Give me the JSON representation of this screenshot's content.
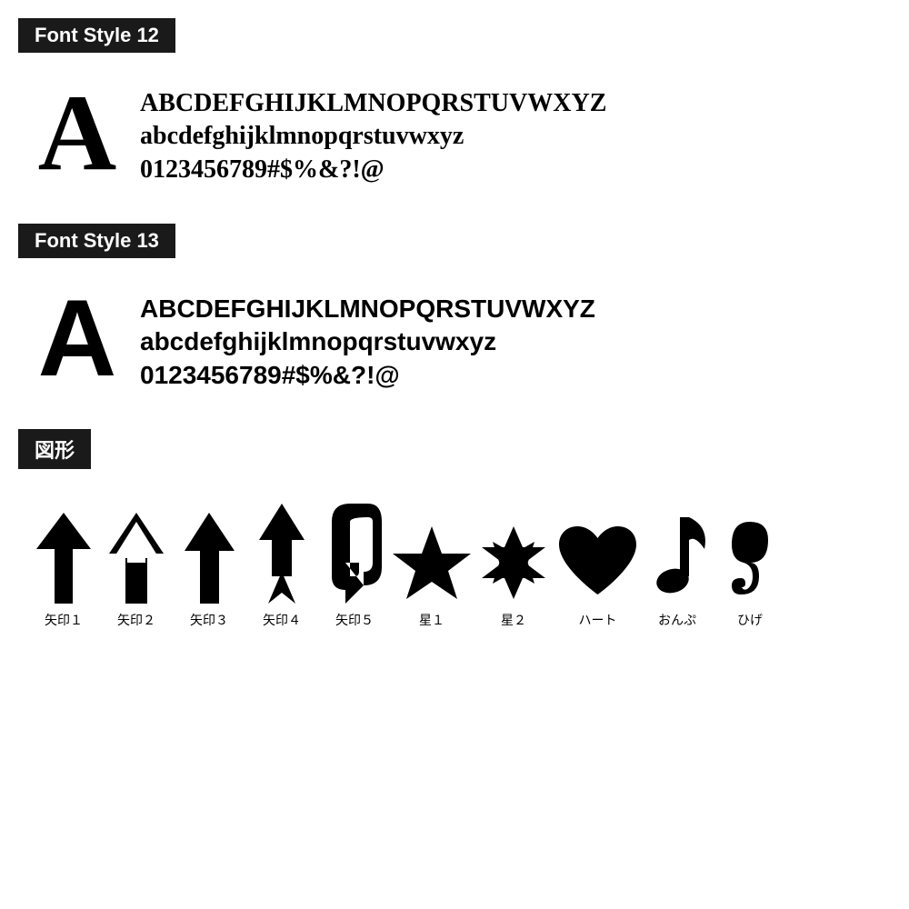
{
  "sections": [
    {
      "id": "font-style-12",
      "label": "Font Style 12",
      "bigLetter": "A",
      "lines": [
        "ABCDEFGHIJKLMNOPQRSTUVWXYZ",
        "abcdefghijklmnopqrstuvwxyz",
        "0123456789#$%&?!@"
      ],
      "styleClass": "style12"
    },
    {
      "id": "font-style-13",
      "label": "Font Style 13",
      "bigLetter": "A",
      "lines": [
        "ABCDEFGHIJKLMNOPQRSTUVWXYZ",
        "abcdefghijklmnopqrstuvwxyz",
        "0123456789#$%&?!@"
      ],
      "styleClass": "style13"
    }
  ],
  "shapesSection": {
    "label": "図形",
    "shapes": [
      {
        "id": "arrow1",
        "label": "矢印１"
      },
      {
        "id": "arrow2",
        "label": "矢印２"
      },
      {
        "id": "arrow3",
        "label": "矢印３"
      },
      {
        "id": "arrow4",
        "label": "矢印４"
      },
      {
        "id": "arrow5",
        "label": "矢印５"
      },
      {
        "id": "star1",
        "label": "星１"
      },
      {
        "id": "star2",
        "label": "星２"
      },
      {
        "id": "heart",
        "label": "ハート"
      },
      {
        "id": "music",
        "label": "おんぷ"
      },
      {
        "id": "curl",
        "label": "ひげ"
      }
    ]
  }
}
